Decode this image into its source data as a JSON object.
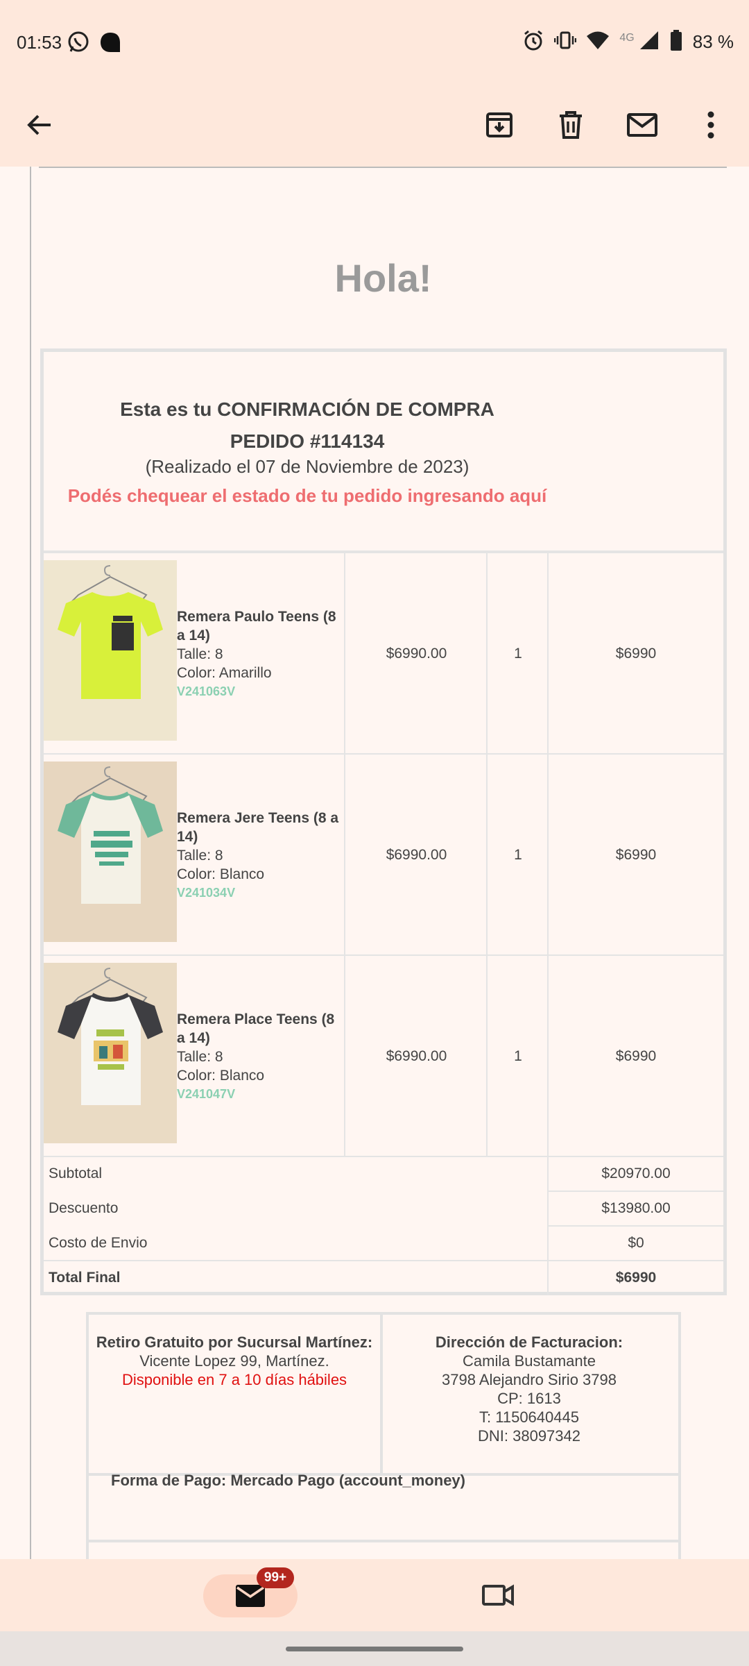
{
  "status_bar": {
    "time": "01:53",
    "network": "4G",
    "battery": "83 %",
    "icons": [
      "whatsapp-icon",
      "app-dot-icon",
      "alarm-icon",
      "vibrate-icon",
      "wifi-icon",
      "signal-icon",
      "battery-icon"
    ]
  },
  "app_bar": {
    "icons": [
      "back-arrow-icon",
      "archive-icon",
      "delete-icon",
      "mark-unread-icon",
      "more-vert-icon"
    ]
  },
  "email": {
    "greeting": "Hola!",
    "confirmation_line": "Esta es tu CONFIRMACIÓN DE COMPRA",
    "order_number": "PEDIDO #114134",
    "order_date": "(Realizado el 07 de Noviembre de 2023)",
    "status_link": "Podés chequear el estado de tu pedido ingresando aquí",
    "items": [
      {
        "name": "Remera Paulo Teens (8 a 14)",
        "size": "Talle: 8",
        "color": "Color: Amarillo",
        "sku": "V241063V",
        "price": "$6990.00",
        "qty": "1",
        "total": "$6990"
      },
      {
        "name": "Remera Jere Teens (8 a 14)",
        "size": "Talle: 8",
        "color": "Color: Blanco",
        "sku": "V241034V",
        "price": "$6990.00",
        "qty": "1",
        "total": "$6990"
      },
      {
        "name": "Remera Place Teens (8 a 14)",
        "size": "Talle: 8",
        "color": "Color: Blanco",
        "sku": "V241047V",
        "price": "$6990.00",
        "qty": "1",
        "total": "$6990"
      }
    ],
    "summary": {
      "subtotal_label": "Subtotal",
      "subtotal": "$20970.00",
      "discount_label": "Descuento",
      "discount": "$13980.00",
      "shipping_label": "Costo de Envio",
      "shipping": "$0",
      "total_label": "Total Final",
      "total": "$6990"
    },
    "pickup": {
      "title": "Retiro Gratuito por Sucursal Martínez:",
      "address": "Vicente Lopez 99, Martínez.",
      "availability": "Disponible en 7 a 10 días hábiles"
    },
    "billing": {
      "title": "Dirección de Facturacion:",
      "name": "Camila Bustamante",
      "street": "3798 Alejandro Sirio 3798",
      "cp": "CP: 1613",
      "phone": "T: 1150640445",
      "dni": "DNI: 38097342"
    },
    "payment": "Forma de Pago: Mercado Pago (account_money)"
  },
  "bottom_nav": {
    "mail_badge": "99+",
    "icons": [
      "mail-icon",
      "video-icon"
    ]
  },
  "colors": {
    "bar_bg": "#fee8dc",
    "page_bg": "#fff6f2",
    "link": "#ee6d70",
    "sku": "#8bd0b2",
    "badge": "#b3261e"
  }
}
